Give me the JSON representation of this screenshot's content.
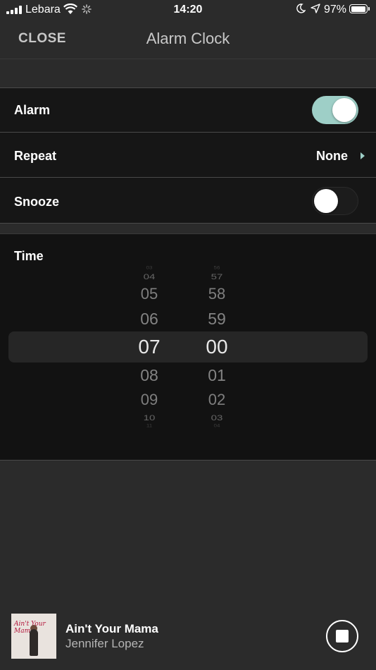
{
  "status_bar": {
    "carrier": "Lebara",
    "time": "14:20",
    "battery_percent": "97%",
    "battery_level": 0.97
  },
  "nav": {
    "close_label": "CLOSE",
    "title": "Alarm Clock"
  },
  "settings": {
    "alarm": {
      "label": "Alarm",
      "enabled": true
    },
    "repeat": {
      "label": "Repeat",
      "value": "None"
    },
    "snooze": {
      "label": "Snooze",
      "enabled": false
    }
  },
  "time_picker": {
    "label": "Time",
    "hours": [
      "03",
      "04",
      "05",
      "06",
      "07",
      "08",
      "09",
      "10",
      "11"
    ],
    "minutes": [
      "56",
      "57",
      "58",
      "59",
      "00",
      "01",
      "02",
      "03",
      "04"
    ],
    "selected_hour": "07",
    "selected_minute": "00"
  },
  "now_playing": {
    "album_text": "Ain't Your Mama",
    "song": "Ain't Your Mama",
    "artist": "Jennifer Lopez"
  },
  "colors": {
    "accent": "#9ecfc7",
    "background": "#2b2b2b",
    "row_background": "#161616"
  }
}
